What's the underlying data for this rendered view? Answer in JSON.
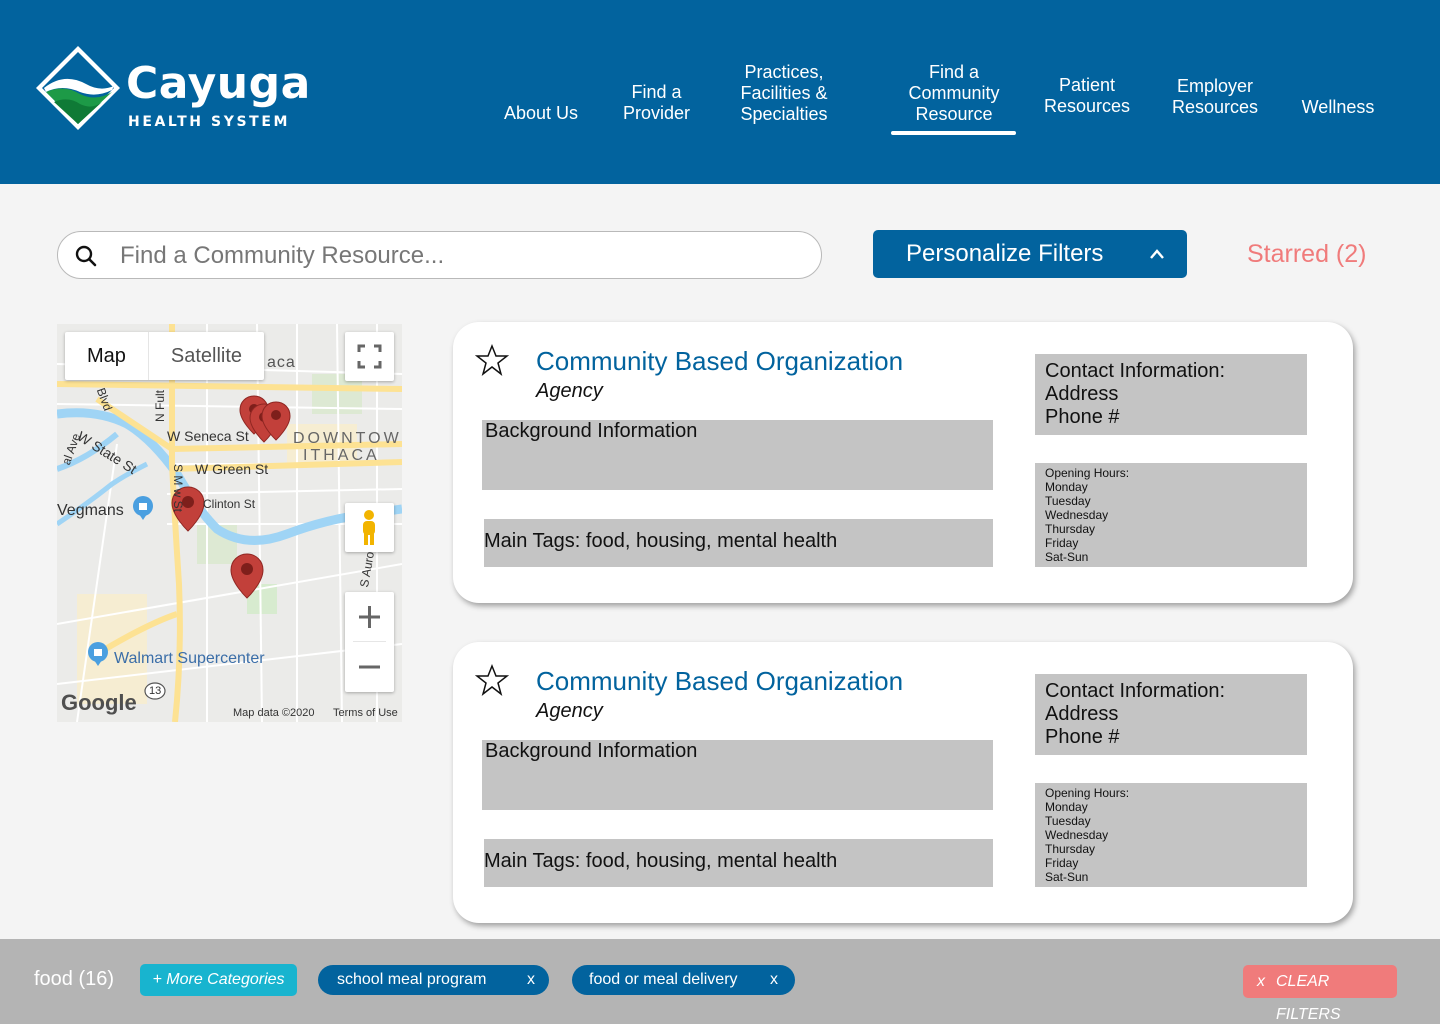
{
  "brand": {
    "name": "Cayuga",
    "tagline": "HEALTH SYSTEM"
  },
  "nav": {
    "items": [
      {
        "label": "About Us"
      },
      {
        "label": "Find a\nProvider"
      },
      {
        "label": "Practices,\nFacilities &\nSpecialties"
      },
      {
        "label": "Find a\nCommunity\nResource",
        "active": true
      },
      {
        "label": "Patient\nResources"
      },
      {
        "label": "Employer\nResources"
      },
      {
        "label": "Wellness"
      }
    ]
  },
  "search": {
    "placeholder": "Find a Community Resource...",
    "value": ""
  },
  "personalize": {
    "label": "Personalize Filters"
  },
  "starred": {
    "label": "Starred (2)"
  },
  "map": {
    "tabs": {
      "map": "Map",
      "satellite": "Satellite"
    },
    "labels": {
      "ithaca_partial": "aca",
      "downtown": "DOWNTOWN",
      "ithaca": "ITHACA",
      "w_seneca": "W Seneca St",
      "w_green": "W Green St",
      "w_state": "W State St",
      "clinton": "Clinton St",
      "vegmans": "Vegmans",
      "walmart": "Walmart Supercenter",
      "route": "13",
      "s_meadow": "S M    w St",
      "n_fulton": "N Fult",
      "blvd": "Blvd",
      "s_aurora": "S Auro",
      "ave": "al Ave"
    },
    "google": "Google",
    "map_data": "Map data ©2020",
    "terms": "Terms of Use"
  },
  "cards": [
    {
      "title": "Community Based Organization",
      "type": "Agency",
      "background": "Background Information",
      "tags": "Main Tags: food, housing, mental health",
      "contact": "Contact Information:\nAddress\nPhone #",
      "hours": "Opening Hours:\nMonday\nTuesday\nWednesday\nThursday\nFriday\nSat-Sun"
    },
    {
      "title": "Community Based Organization",
      "type": "Agency",
      "background": "Background Information",
      "tags": "Main Tags: food, housing, mental health",
      "contact": "Contact Information:\nAddress\nPhone #",
      "hours": "Opening Hours:\nMonday\nTuesday\nWednesday\nThursday\nFriday\nSat-Sun"
    }
  ],
  "filters": {
    "category": "food (16)",
    "more": "+  More Categories",
    "chips": [
      {
        "label": "school meal program",
        "remove": "x"
      },
      {
        "label": "food or meal delivery",
        "remove": "x"
      }
    ],
    "clear": {
      "x": "x",
      "label": "CLEAR FILTERS"
    }
  },
  "colors": {
    "primary": "#02639e",
    "accent_red": "#f07b7b",
    "accent_teal": "#18b4cf",
    "panel_gray": "#c4c4c4",
    "bar_gray": "#b4b4b4"
  }
}
